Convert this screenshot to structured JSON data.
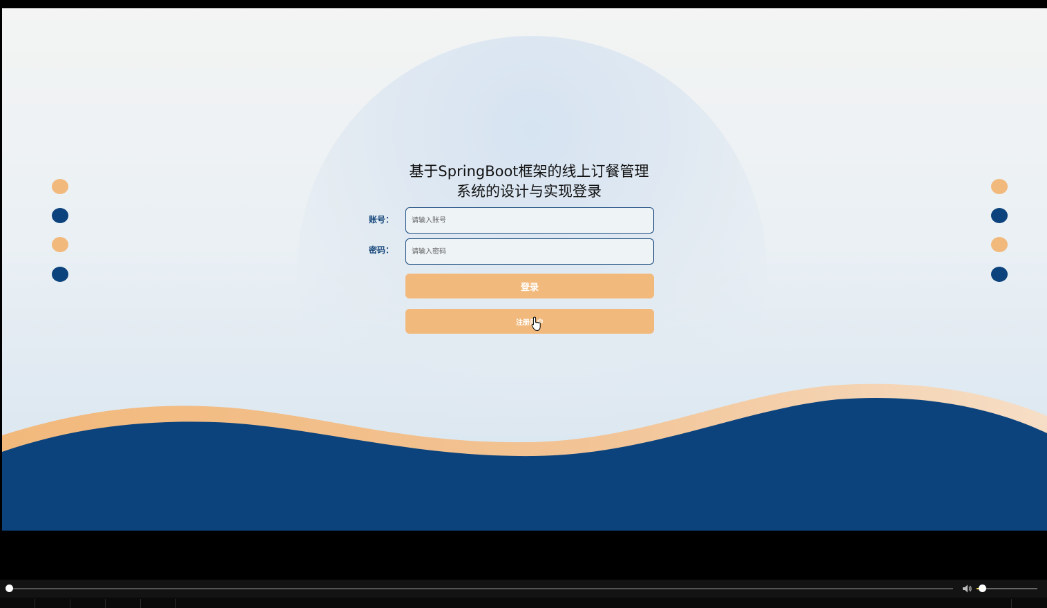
{
  "login": {
    "title": "基于SpringBoot框架的线上订餐管理系统的设计与实现登录",
    "account_label": "账号：",
    "account_placeholder": "请输入账号",
    "password_label": "密码：",
    "password_placeholder": "请输入密码",
    "login_button": "登录",
    "register_button": "注册用户"
  },
  "colors": {
    "accent_orange": "#f2b97c",
    "primary_blue": "#0c437d"
  },
  "player": {
    "seek_progress": 0,
    "volume_level": 0.1
  },
  "icons": {
    "cursor": "hand-pointer-icon",
    "volume": "speaker-icon"
  }
}
